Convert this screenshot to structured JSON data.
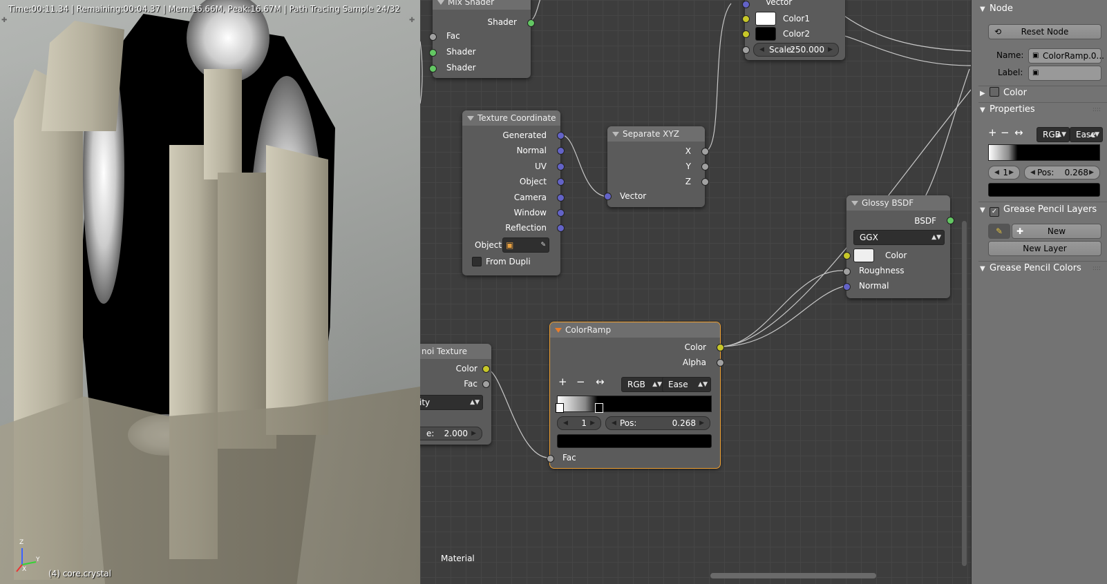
{
  "viewport": {
    "status": "Time:00:11.34 | Remaining:00:04.37 | Mem:16.66M, Peak:16.67M | Path Tracing Sample 24/32",
    "object": "(4) core.crystal",
    "axis_x": "X",
    "axis_y": "Y",
    "axis_z": "Z"
  },
  "editor": {
    "label": "Material",
    "nodes": {
      "mix_shader": {
        "title": "Mix Shader",
        "out": "Shader",
        "in_fac": "Fac",
        "in_shader1": "Shader",
        "in_shader2": "Shader"
      },
      "checker": {
        "out_vector": "Vector",
        "color1": "Color1",
        "color2": "Color2",
        "scale_label": "Scale:",
        "scale_value": "250.000"
      },
      "texcoord": {
        "title": "Texture Coordinate",
        "generated": "Generated",
        "normal": "Normal",
        "uv": "UV",
        "object": "Object",
        "camera": "Camera",
        "window": "Window",
        "reflection": "Reflection",
        "object_label": "Object",
        "from_dupli": "From Dupli"
      },
      "separate": {
        "title": "Separate XYZ",
        "x": "X",
        "y": "Y",
        "z": "Z",
        "vector": "Vector"
      },
      "glossy": {
        "title": "Glossy BSDF",
        "out": "BSDF",
        "dist": "GGX",
        "color": "Color",
        "roughness": "Roughness",
        "normal": "Normal"
      },
      "voronoi": {
        "title_partial": "noi Texture",
        "color": "Color",
        "fac": "Fac",
        "coloring_partial": "ity",
        "scale_partial": "e:",
        "scale_value": "2.000"
      },
      "colorramp": {
        "title": "ColorRamp",
        "out_color": "Color",
        "out_alpha": "Alpha",
        "mode": "RGB",
        "interp": "Ease",
        "index": "1",
        "pos_label": "Pos:",
        "pos_value": "0.268",
        "in_fac": "Fac"
      }
    }
  },
  "panel": {
    "node_header": "Node",
    "reset_node": "Reset Node",
    "name_label": "Name:",
    "name_value": "ColorRamp.0...",
    "label_label": "Label:",
    "color_header": "Color",
    "properties_header": "Properties",
    "mode": "RGB",
    "interp": "Ease",
    "index": "1",
    "pos_label": "Pos:",
    "pos_value": "0.268",
    "gp_layers_header": "Grease Pencil Layers",
    "new_button": "New",
    "new_layer_button": "New Layer",
    "gp_colors_header": "Grease Pencil Colors"
  }
}
